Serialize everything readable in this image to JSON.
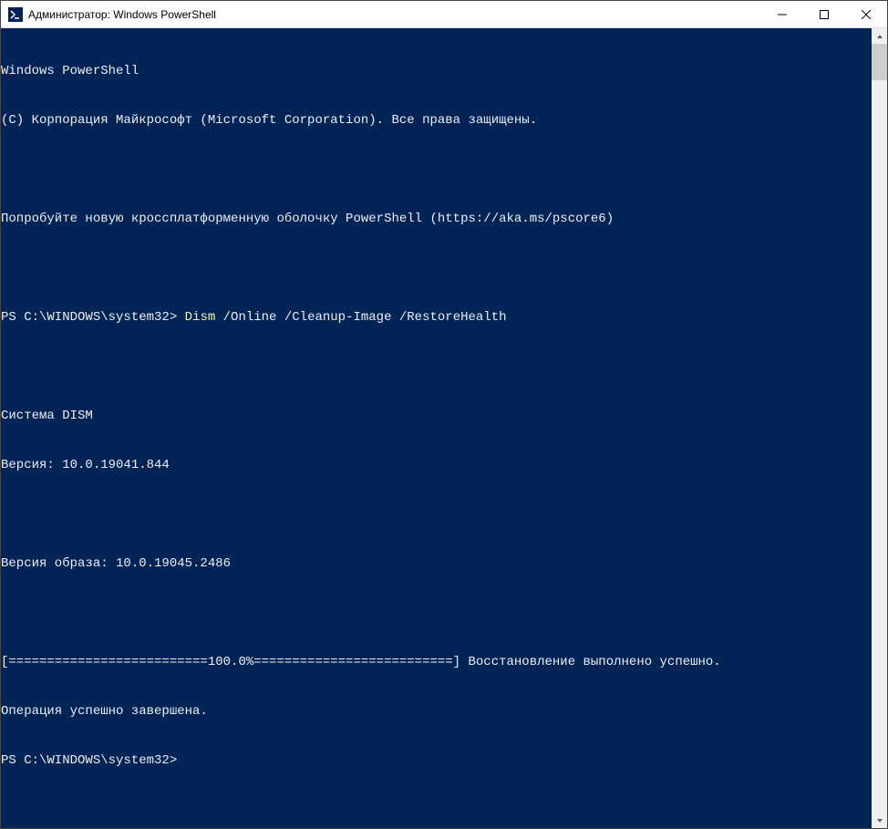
{
  "window": {
    "title": "Администратор: Windows PowerShell"
  },
  "terminal": {
    "header1": "Windows PowerShell",
    "header2": "(C) Корпорация Майкрософт (Microsoft Corporation). Все права защищены.",
    "promo": "Попробуйте новую кроссплатформенную оболочку PowerShell (https://aka.ms/pscore6)",
    "prompt1": "PS C:\\WINDOWS\\system32> ",
    "command": "Dism",
    "args": " /Online /Cleanup-Image /RestoreHealth",
    "dism_header": "Cистема DISM",
    "dism_version": "Версия: 10.0.19041.844",
    "image_version": "Версия образа: 10.0.19045.2486",
    "progress": "[==========================100.0%==========================] Восстановление выполнено успешно.",
    "completion": "Операция успешно завершена.",
    "prompt2": "PS C:\\WINDOWS\\system32>"
  }
}
